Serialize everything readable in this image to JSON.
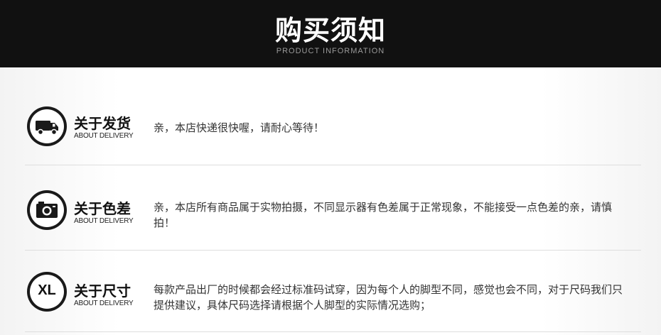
{
  "header": {
    "title": "购买须知",
    "subtitle": "PRODUCT INFORMATION"
  },
  "sections": [
    {
      "icon": "truck-icon",
      "title": "关于发货",
      "subtitle": "ABOUT DELIVERY",
      "text": "亲，本店快递很快喔，请耐心等待！"
    },
    {
      "icon": "camera-icon",
      "title": "关于色差",
      "subtitle": "ABOUT DELIVERY",
      "text": "亲，本店所有商品属于实物拍摄，不同显示器有色差属于正常现象，不能接受一点色差的亲，请慎拍！"
    },
    {
      "icon": "size-xl-icon",
      "icon_text": "XL",
      "title": "关于尺寸",
      "subtitle": "ABOUT DELIVERY",
      "text": "每款产品出厂的时候都会经过标准码试穿，因为每个人的脚型不同，感觉也会不同，对于尺码我们只提供建议，具体尺码选择请根据个人脚型的实际情况选购；"
    }
  ]
}
